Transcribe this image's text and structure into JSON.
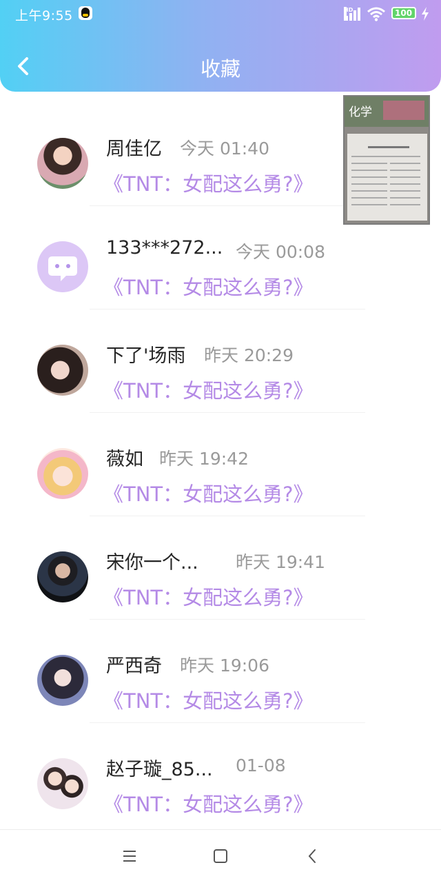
{
  "status_bar": {
    "time": "上午9:55",
    "network": "HD",
    "battery": "100",
    "icons": [
      "qq-icon",
      "signal-icon",
      "wifi-icon",
      "battery-icon",
      "charging-icon"
    ]
  },
  "header": {
    "title": "收藏",
    "back_icon": "back-arrow-icon",
    "gradient": [
      "#52d0f4",
      "#c09cef"
    ]
  },
  "items": [
    {
      "name": "周佳亿",
      "time": "今天 01:40",
      "book": "《TNT：女配这么勇?》"
    },
    {
      "name": "133***272...",
      "time": "今天 00:08",
      "book": "《TNT：女配这么勇?》"
    },
    {
      "name": "下了'场雨",
      "time": "昨天 20:29",
      "book": "《TNT：女配这么勇?》"
    },
    {
      "name": "薇如",
      "time": "昨天 19:42",
      "book": "《TNT：女配这么勇?》"
    },
    {
      "name": "宋你一个...",
      "time": "昨天 19:41",
      "book": "《TNT：女配这么勇?》"
    },
    {
      "name": "严西奇",
      "time": "昨天 19:06",
      "book": "《TNT：女配这么勇?》"
    },
    {
      "name": "赵子璇_85...",
      "time": "01-08",
      "book": "《TNT：女配这么勇?》"
    }
  ],
  "floating_window": {
    "label": "化学"
  },
  "colors": {
    "book_title": "#b48ae6",
    "time_text": "#9a9a9a"
  },
  "nav_bar": {
    "icons": [
      "menu-icon",
      "home-icon",
      "back-icon"
    ]
  }
}
